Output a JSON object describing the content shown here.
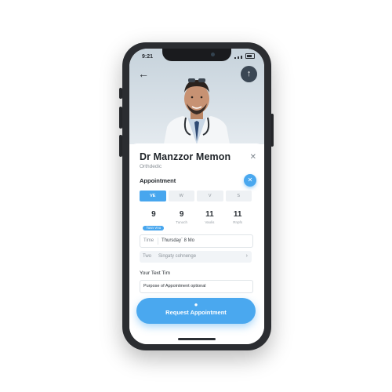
{
  "status_bar": {
    "time": "9:21"
  },
  "header": {
    "back_icon": "arrow-left-icon",
    "upload_icon": "arrow-up-icon"
  },
  "doctor": {
    "name": "Dr Manzzor Memon",
    "specialty": "Orthdedic"
  },
  "appointment": {
    "title": "Appointment",
    "days": [
      {
        "label": "VE",
        "active": true
      },
      {
        "label": "W",
        "active": false
      },
      {
        "label": "V",
        "active": false
      },
      {
        "label": "S",
        "active": false
      }
    ],
    "dates": [
      {
        "num": "9",
        "label": "Tosn Vno",
        "active": true
      },
      {
        "num": "9",
        "label": "Tunoch",
        "active": false
      },
      {
        "num": "11",
        "label": "Vaolis",
        "active": false
      },
      {
        "num": "11",
        "label": "Rnpfs",
        "active": false
      }
    ],
    "time_row": {
      "key": "Time",
      "value": "Thursday` 8 Mo"
    },
    "two_row": {
      "key": "Two",
      "value": "Singaty cohnenge"
    }
  },
  "text_section": {
    "title": "Your Text Tim",
    "placeholder": "Purpose of Appointment optional"
  },
  "cta": {
    "label": "Request Appointment"
  },
  "colors": {
    "accent": "#4aa8ef",
    "dark": "#2b2d31"
  }
}
